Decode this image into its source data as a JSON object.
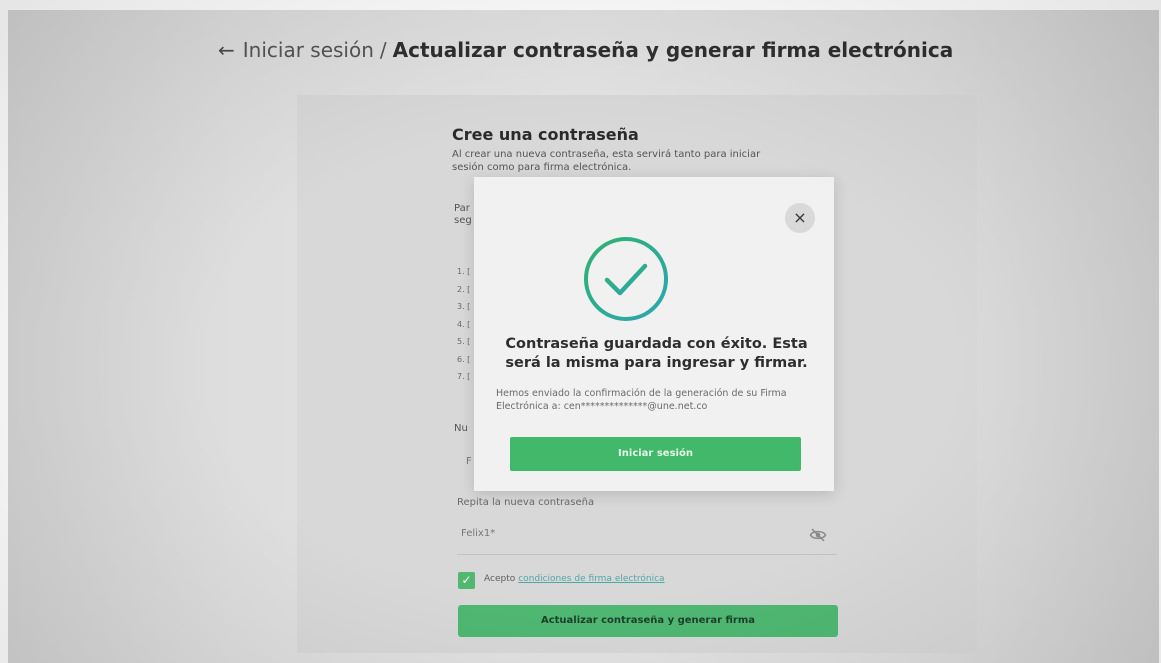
{
  "header": {
    "back_arrow": "←",
    "breadcrumb_root": "Iniciar sesión",
    "separator": "/",
    "title": "Actualizar contraseña y generar firma electrónica"
  },
  "form": {
    "heading": "Cree una contraseña",
    "intro": "Al crear una nueva contraseña, esta servirá tanto para iniciar sesión como para firma electrónica.",
    "para_partial_1": "Par",
    "para_partial_2": "seg",
    "rules_partial": [
      "1. [",
      "2. [",
      "3. [",
      "4. [",
      "5. [",
      "6. [",
      "7. ["
    ],
    "new_password_label_partial": "Nu",
    "new_password_value_partial": "F",
    "repeat_label": "Repita la nueva contraseña",
    "repeat_value": "Felix1*",
    "eye_icon": "eye-off-icon",
    "accept_text": "Acepto",
    "accept_link": "condiciones de firma electrónica",
    "submit_label": "Actualizar contraseña y generar firma"
  },
  "modal": {
    "close_label": "×",
    "success_icon": "check-circle-icon",
    "title": "Contraseña guardada con éxito. Esta será la misma para ingresar y firmar.",
    "description": "Hemos enviado la confirmación de la generación de su Firma Electrónica a: cen**************@une.net.co",
    "button_label": "Iniciar sesión"
  },
  "colors": {
    "primary_green": "#42b86a",
    "check_gradient_start": "#2fb36d",
    "check_gradient_end": "#2aa6b3"
  }
}
